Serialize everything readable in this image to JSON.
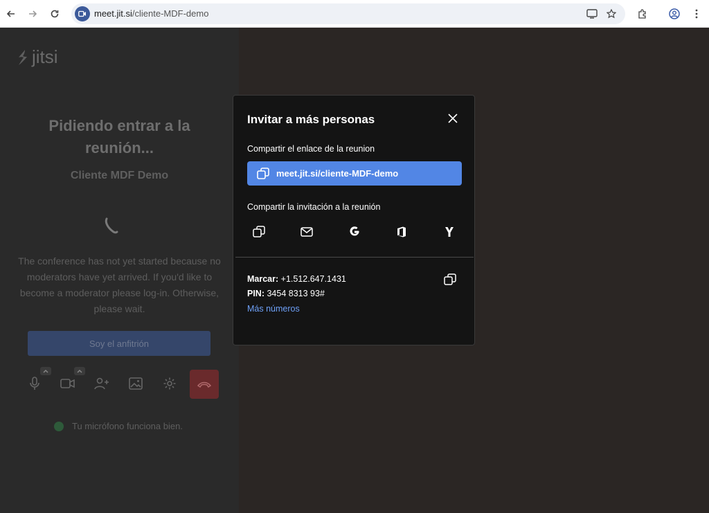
{
  "browser": {
    "url_host": "meet.jit.si",
    "url_path": "/cliente-MDF-demo",
    "icons": [
      "back-icon",
      "forward-icon",
      "reload-icon",
      "video-site-icon",
      "cast-icon",
      "star-icon",
      "extensions-icon",
      "profile-icon",
      "menu-icon"
    ]
  },
  "logo": {
    "text": "jitsi"
  },
  "prejoin": {
    "title": "Pidiendo entrar a la reunión...",
    "meeting_name": "Cliente MDF Demo",
    "message": "The conference has not yet started because no moderators have yet arrived. If you'd like to become a moderator please log-in. Otherwise, please wait.",
    "host_button": "Soy el anfitrión",
    "mic_status": "Tu micrófono funciona bien."
  },
  "modal": {
    "title": "Invitar a más personas",
    "share_link_label": "Compartir el enlace de la reunion",
    "link": "meet.jit.si/cliente-MDF-demo",
    "share_invite_label": "Compartir la invitación a la reunión",
    "share_options": [
      "copy-icon",
      "email-icon",
      "google-icon",
      "office-icon",
      "yahoo-icon"
    ],
    "dial_label": "Marcar:",
    "dial_number": "+1.512.647.1431",
    "pin_label": "PIN:",
    "pin_value": "3454 8313 93#",
    "more_numbers": "Más números"
  },
  "colors": {
    "accent": "#5286e5",
    "link": "#6ea0f7",
    "modal_bg": "#141414",
    "hangup": "#6a2a2c"
  }
}
